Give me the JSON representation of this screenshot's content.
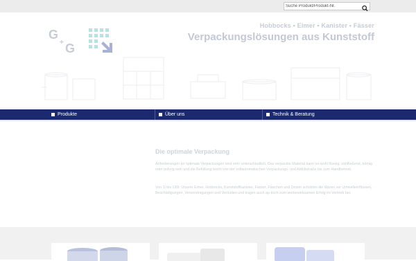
{
  "search": {
    "placeholder": "Suche Produkt/Produkt-Nr."
  },
  "header": {
    "tagline": "Hobbocks • Eimer • Kanister • Fässer",
    "title": "Verpackungslösungen aus Kunststoff"
  },
  "logo": {
    "letter1": "G",
    "letter2": "G",
    "plus": "+"
  },
  "nav": {
    "items": [
      {
        "label": "Produkte"
      },
      {
        "label": "Über uns"
      },
      {
        "label": "Technik & Beratung"
      }
    ]
  },
  "content": {
    "title": "Die optimale Verpackung",
    "p1": "Anforderungen an optimale Verpackungen sind sehr unterschiedlich. Das verpackte Material kann so-wohl flüssig, zähfließend, körnig oder pulvrig sein und die Befüllung reicht von der vollautomatischen Verpackungs- und Abfüllstraße bis zum Handbetrieb.",
    "p2": "Von 1l bis 130l: Unsere Eimer, Hobbocks, Kunststoffkanister, Fässer, Flaschen und Dosen schützen die Waren vor Umwelteinflüssen, Beschädigungen, Verunreinigungen und Verlusten und tragen auch ap-tisch zum werbewirksamen Erfolg im Vertrieb bei."
  },
  "colors": {
    "nav": "#1b2a6e",
    "accent_blue": "#4c5ba6",
    "accent_teal": "#8fcfcf"
  }
}
